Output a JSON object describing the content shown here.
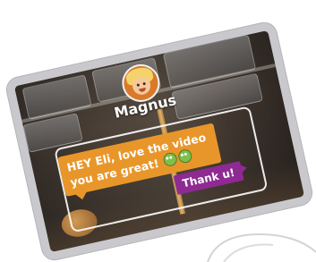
{
  "profile": {
    "username": "Magnus",
    "avatar_icon": "cartoon-boy-avatar-icon"
  },
  "chat": {
    "incoming": {
      "line1": "HEY Eli, love the video",
      "line2": "you are great!",
      "emoji_icon": "green-face-emoji-icon",
      "color": "#e8962a"
    },
    "outgoing": {
      "text": "Thank u!",
      "color": "#8e2a92"
    }
  }
}
